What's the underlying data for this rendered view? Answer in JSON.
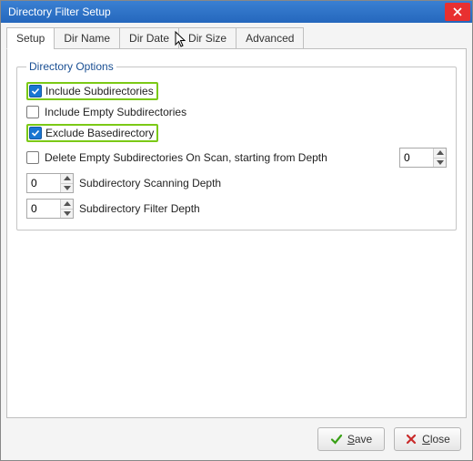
{
  "title": "Directory Filter Setup",
  "tabs": [
    "Setup",
    "Dir Name",
    "Dir Date",
    "Dir Size",
    "Advanced"
  ],
  "activeTabIndex": 0,
  "group": {
    "legend": "Directory Options",
    "opt_include_sub": {
      "label": "Include Subdirectories",
      "checked": true,
      "highlighted": true
    },
    "opt_include_empty": {
      "label": "Include Empty Subdirectories",
      "checked": false
    },
    "opt_exclude_base": {
      "label": "Exclude Basedirectory",
      "checked": true,
      "highlighted": true
    },
    "opt_delete_empty": {
      "label": "Delete Empty Subdirectories On Scan, starting from Depth",
      "checked": false,
      "value": "0"
    },
    "opt_scan_depth": {
      "label": "Subdirectory Scanning Depth",
      "value": "0"
    },
    "opt_filter_depth": {
      "label": "Subdirectory Filter Depth",
      "value": "0"
    }
  },
  "buttons": {
    "save": "Save",
    "close": "Close"
  }
}
